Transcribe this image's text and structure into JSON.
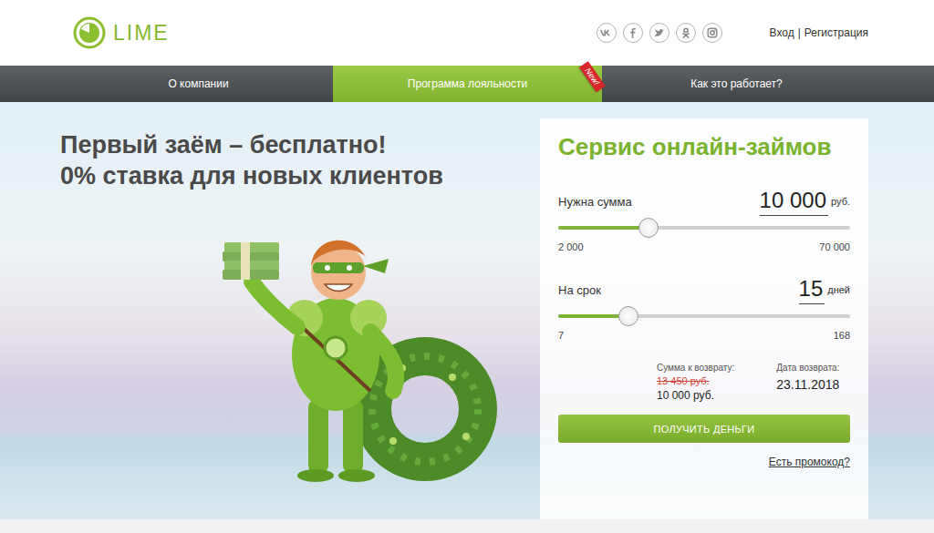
{
  "logo": {
    "text": "LIME"
  },
  "social": [
    {
      "kind": "vk"
    },
    {
      "kind": "facebook"
    },
    {
      "kind": "twitter"
    },
    {
      "kind": "odnoklassniki"
    },
    {
      "kind": "instagram"
    }
  ],
  "auth": {
    "login": "Вход",
    "separator": "|",
    "register": "Регистрация"
  },
  "nav": [
    {
      "label": "О компании",
      "selected": false,
      "badge": ""
    },
    {
      "label": "Программа лояльности",
      "selected": true,
      "badge": "New!"
    },
    {
      "label": "Как это работает?",
      "selected": false,
      "badge": ""
    }
  ],
  "hero": {
    "title_lines": [
      "Первый заём – бесплатно!",
      "0% ставка для новых клиентов"
    ]
  },
  "calculator": {
    "title": "Сервис онлайн-займов",
    "sliders": [
      {
        "label": "Нужна сумма",
        "value": "10 000",
        "unit": "руб.",
        "min": "2 000",
        "max": "70 000",
        "level": 0.31
      },
      {
        "label": "На срок",
        "value": "15",
        "unit": "дней",
        "min": "7",
        "max": "168",
        "level": 0.24
      }
    ],
    "repayment": {
      "label": "Сумма к возврату:",
      "amounts": [
        {
          "text": "13 450 руб.",
          "struck": true
        },
        {
          "text": "10 000 руб.",
          "struck": false
        }
      ]
    },
    "date": {
      "label": "Дата возврата:",
      "value": "23.11.2018"
    },
    "button": "ПОЛУЧИТЬ ДЕНЬГИ",
    "promo": "Есть промокод?"
  }
}
